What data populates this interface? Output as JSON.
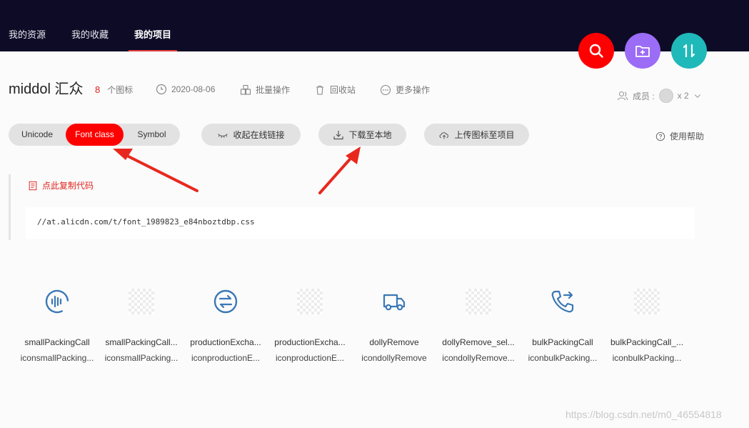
{
  "topnav": {
    "items": [
      {
        "label": "我的资源"
      },
      {
        "label": "我的收藏"
      },
      {
        "label": "我的项目"
      }
    ]
  },
  "fabs": {
    "search_color": "#ff0000",
    "add_folder_color": "#9b6cf6",
    "sort_color": "#1fb9b9"
  },
  "project": {
    "title": "middol 汇众",
    "icon_count": "8",
    "icon_count_label": "个图标",
    "date": "2020-08-06",
    "batch_label": "批量操作",
    "recycle_label": "回收站",
    "more_label": "更多操作",
    "members_label": "成员 :",
    "members_count": "x 2"
  },
  "tabs": {
    "items": [
      {
        "label": "Unicode"
      },
      {
        "label": "Font class"
      },
      {
        "label": "Symbol"
      }
    ],
    "active": "Font class"
  },
  "actions": {
    "collapse_label": "收起在线链接",
    "download_label": "下载至本地",
    "upload_label": "上传图标至项目",
    "help_label": "使用帮助"
  },
  "code": {
    "copy_label": "点此复制代码",
    "url": "//at.alicdn.com/t/font_1989823_e84nboztdbp.css"
  },
  "icons": [
    {
      "name": "smallPackingCall",
      "cls": "iconsmallPacking...",
      "icon": "sound-wave-icon"
    },
    {
      "name": "smallPackingCall...",
      "cls": "iconsmallPacking...",
      "icon": "transparent-placeholder-icon"
    },
    {
      "name": "productionExcha...",
      "cls": "iconproductionE...",
      "icon": "exchange-arrows-icon"
    },
    {
      "name": "productionExcha...",
      "cls": "iconproductionE...",
      "icon": "transparent-placeholder-icon"
    },
    {
      "name": "dollyRemove",
      "cls": "icondollyRemove",
      "icon": "truck-icon"
    },
    {
      "name": "dollyRemove_sel...",
      "cls": "icondollyRemove...",
      "icon": "transparent-placeholder-icon"
    },
    {
      "name": "bulkPackingCall",
      "cls": "iconbulkPacking...",
      "icon": "phone-forward-icon"
    },
    {
      "name": "bulkPackingCall_...",
      "cls": "iconbulkPacking...",
      "icon": "transparent-placeholder-icon"
    }
  ],
  "watermark": "https://blog.csdn.net/m0_46554818",
  "colors": {
    "accent_red": "#ff0000",
    "icon_blue": "#3a78b6",
    "topbar": "#0d0b26"
  }
}
